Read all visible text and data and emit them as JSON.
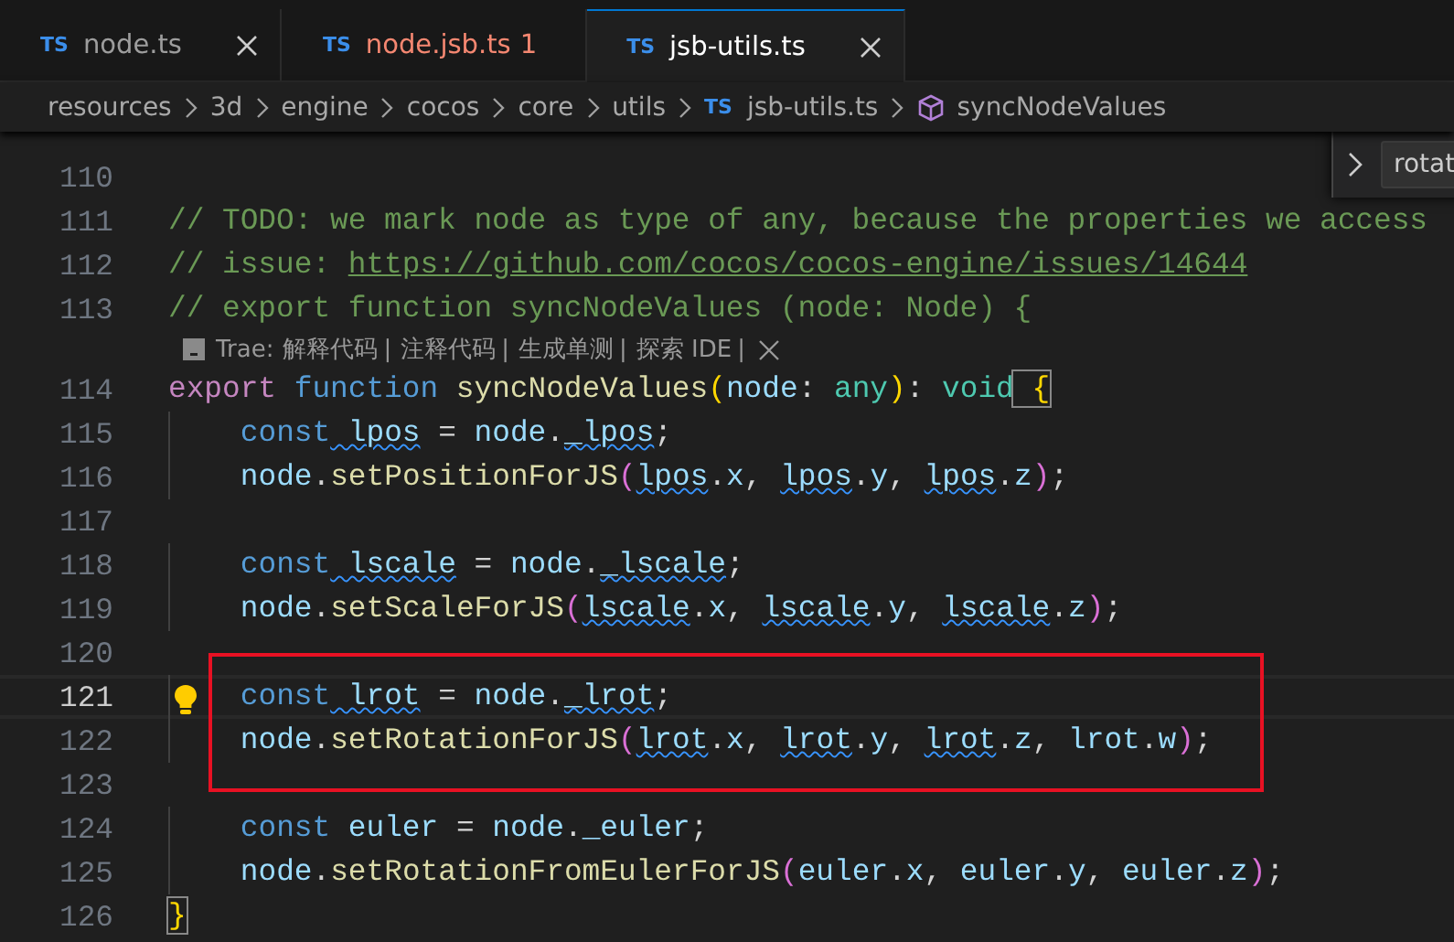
{
  "tabs": [
    {
      "icon_text": "TS",
      "label": "node.ts",
      "selected": false,
      "error": false,
      "closable": true
    },
    {
      "icon_text": "TS",
      "label": "node.jsb.ts",
      "selected": false,
      "error": true,
      "problems": "1",
      "closable": false
    },
    {
      "icon_text": "TS",
      "label": "jsb-utils.ts",
      "selected": true,
      "error": false,
      "closable": true
    }
  ],
  "breadcrumb": [
    {
      "kind": "folder",
      "label": "resources"
    },
    {
      "kind": "folder",
      "label": "3d"
    },
    {
      "kind": "folder",
      "label": "engine"
    },
    {
      "kind": "folder",
      "label": "cocos"
    },
    {
      "kind": "folder",
      "label": "core"
    },
    {
      "kind": "folder",
      "label": "utils"
    },
    {
      "kind": "file",
      "icon_text": "TS",
      "label": "jsb-utils.ts"
    },
    {
      "kind": "symbol",
      "label": "syncNodeValues"
    }
  ],
  "find_widget": {
    "value": "rotat"
  },
  "lines": [
    {
      "kind": "code",
      "number": "110",
      "current": false,
      "indented": false
    },
    {
      "kind": "code",
      "number": "111",
      "current": false,
      "indented": false,
      "tokens": [
        {
          "text": "// TODO: we mark node as type of any, because the properties we access",
          "kind": "comment"
        }
      ]
    },
    {
      "kind": "code",
      "number": "112",
      "current": false,
      "indented": false,
      "tokens": [
        {
          "text": "// issue: ",
          "kind": "comment"
        },
        {
          "text": "https://github.com/cocos/cocos-engine/issues/14644",
          "kind": "link"
        }
      ]
    },
    {
      "kind": "code",
      "number": "113",
      "current": false,
      "indented": false,
      "tokens": [
        {
          "text": "// export function syncNodeValues (node: Node) {",
          "kind": "comment"
        }
      ]
    },
    {
      "kind": "codelens",
      "label": "Trae:",
      "actions": [
        "解释代码",
        "注释代码",
        "生成单测",
        "探索 IDE"
      ],
      "separator": "|"
    },
    {
      "kind": "code",
      "number": "114",
      "current": false,
      "indented": false,
      "tokens": [
        {
          "text": "export",
          "kind": "keyword"
        },
        {
          "text": " function",
          "kind": "storage"
        },
        {
          "text": " syncNodeValues",
          "kind": "function"
        },
        {
          "text": "(",
          "kind": "bracket1"
        },
        {
          "text": "node",
          "kind": "variable"
        },
        {
          "text": ": ",
          "kind": "punct"
        },
        {
          "text": "any",
          "kind": "type"
        },
        {
          "text": ")",
          "kind": "bracket1"
        },
        {
          "text": ": ",
          "kind": "punct"
        },
        {
          "text": "void",
          "kind": "type"
        },
        {
          "text": " {",
          "kind": "bracket_match"
        }
      ]
    },
    {
      "kind": "code",
      "number": "115",
      "current": false,
      "indented": true,
      "tokens": [
        {
          "text": "const",
          "kind": "storage"
        },
        {
          "text": " lpos",
          "kind": "warned"
        },
        {
          "text": " = ",
          "kind": "punct"
        },
        {
          "text": "node",
          "kind": "variable"
        },
        {
          "text": ".",
          "kind": "punct"
        },
        {
          "text": "_lpos",
          "kind": "warned"
        },
        {
          "text": ";",
          "kind": "punct"
        }
      ]
    },
    {
      "kind": "code",
      "number": "116",
      "current": false,
      "indented": true,
      "tokens": [
        {
          "text": "node",
          "kind": "variable"
        },
        {
          "text": ".",
          "kind": "punct"
        },
        {
          "text": "setPositionForJS",
          "kind": "function"
        },
        {
          "text": "(",
          "kind": "bracket2"
        },
        {
          "text": "lpos",
          "kind": "warned"
        },
        {
          "text": ".",
          "kind": "punct"
        },
        {
          "text": "x",
          "kind": "variable"
        },
        {
          "text": ", ",
          "kind": "punct"
        },
        {
          "text": "lpos",
          "kind": "warned"
        },
        {
          "text": ".",
          "kind": "punct"
        },
        {
          "text": "y",
          "kind": "variable"
        },
        {
          "text": ", ",
          "kind": "punct"
        },
        {
          "text": "lpos",
          "kind": "warned"
        },
        {
          "text": ".",
          "kind": "punct"
        },
        {
          "text": "z",
          "kind": "variable"
        },
        {
          "text": ")",
          "kind": "bracket2"
        },
        {
          "text": ";",
          "kind": "punct"
        }
      ]
    },
    {
      "kind": "code",
      "number": "117",
      "current": false,
      "indented": false
    },
    {
      "kind": "code",
      "number": "118",
      "current": false,
      "indented": true,
      "tokens": [
        {
          "text": "const",
          "kind": "storage"
        },
        {
          "text": " lscale",
          "kind": "warned"
        },
        {
          "text": " = ",
          "kind": "punct"
        },
        {
          "text": "node",
          "kind": "variable"
        },
        {
          "text": ".",
          "kind": "punct"
        },
        {
          "text": "_lscale",
          "kind": "warned"
        },
        {
          "text": ";",
          "kind": "punct"
        }
      ]
    },
    {
      "kind": "code",
      "number": "119",
      "current": false,
      "indented": true,
      "tokens": [
        {
          "text": "node",
          "kind": "variable"
        },
        {
          "text": ".",
          "kind": "punct"
        },
        {
          "text": "setScaleForJS",
          "kind": "function"
        },
        {
          "text": "(",
          "kind": "bracket2"
        },
        {
          "text": "lscale",
          "kind": "warned"
        },
        {
          "text": ".",
          "kind": "punct"
        },
        {
          "text": "x",
          "kind": "variable"
        },
        {
          "text": ", ",
          "kind": "punct"
        },
        {
          "text": "lscale",
          "kind": "warned"
        },
        {
          "text": ".",
          "kind": "punct"
        },
        {
          "text": "y",
          "kind": "variable"
        },
        {
          "text": ", ",
          "kind": "punct"
        },
        {
          "text": "lscale",
          "kind": "warned"
        },
        {
          "text": ".",
          "kind": "punct"
        },
        {
          "text": "z",
          "kind": "variable"
        },
        {
          "text": ")",
          "kind": "bracket2"
        },
        {
          "text": ";",
          "kind": "punct"
        }
      ]
    },
    {
      "kind": "code",
      "number": "120",
      "current": false,
      "indented": false
    },
    {
      "kind": "code",
      "number": "121",
      "current": true,
      "indented": true,
      "tokens": [
        {
          "text": "const",
          "kind": "storage"
        },
        {
          "text": " lrot",
          "kind": "warned"
        },
        {
          "text": " = ",
          "kind": "punct"
        },
        {
          "text": "node",
          "kind": "variable"
        },
        {
          "text": ".",
          "kind": "punct"
        },
        {
          "text": "_lrot",
          "kind": "warned"
        },
        {
          "text": ";",
          "kind": "punct"
        }
      ]
    },
    {
      "kind": "code",
      "number": "122",
      "current": false,
      "indented": true,
      "tokens": [
        {
          "text": "node",
          "kind": "variable"
        },
        {
          "text": ".",
          "kind": "punct"
        },
        {
          "text": "setRotationForJS",
          "kind": "function"
        },
        {
          "text": "(",
          "kind": "bracket2"
        },
        {
          "text": "lrot",
          "kind": "warned"
        },
        {
          "text": ".",
          "kind": "punct"
        },
        {
          "text": "x",
          "kind": "variable"
        },
        {
          "text": ", ",
          "kind": "punct"
        },
        {
          "text": "lrot",
          "kind": "warned"
        },
        {
          "text": ".",
          "kind": "punct"
        },
        {
          "text": "y",
          "kind": "variable"
        },
        {
          "text": ", ",
          "kind": "punct"
        },
        {
          "text": "lrot",
          "kind": "warned"
        },
        {
          "text": ".",
          "kind": "punct"
        },
        {
          "text": "z",
          "kind": "variable"
        },
        {
          "text": ", ",
          "kind": "punct"
        },
        {
          "text": "lrot",
          "kind": "variable"
        },
        {
          "text": ".",
          "kind": "punct"
        },
        {
          "text": "w",
          "kind": "variable"
        },
        {
          "text": ")",
          "kind": "bracket2"
        },
        {
          "text": ";",
          "kind": "punct"
        }
      ]
    },
    {
      "kind": "code",
      "number": "123",
      "current": false,
      "indented": false
    },
    {
      "kind": "code",
      "number": "124",
      "current": false,
      "indented": true,
      "tokens": [
        {
          "text": "const",
          "kind": "storage"
        },
        {
          "text": " euler",
          "kind": "variable"
        },
        {
          "text": " = ",
          "kind": "punct"
        },
        {
          "text": "node",
          "kind": "variable"
        },
        {
          "text": ".",
          "kind": "punct"
        },
        {
          "text": "_euler",
          "kind": "variable"
        },
        {
          "text": ";",
          "kind": "punct"
        }
      ]
    },
    {
      "kind": "code",
      "number": "125",
      "current": false,
      "indented": true,
      "tokens": [
        {
          "text": "node",
          "kind": "variable"
        },
        {
          "text": ".",
          "kind": "punct"
        },
        {
          "text": "setRotationFromEulerForJS",
          "kind": "function"
        },
        {
          "text": "(",
          "kind": "bracket2"
        },
        {
          "text": "euler",
          "kind": "variable"
        },
        {
          "text": ".",
          "kind": "punct"
        },
        {
          "text": "x",
          "kind": "variable"
        },
        {
          "text": ", ",
          "kind": "punct"
        },
        {
          "text": "euler",
          "kind": "variable"
        },
        {
          "text": ".",
          "kind": "punct"
        },
        {
          "text": "y",
          "kind": "variable"
        },
        {
          "text": ", ",
          "kind": "punct"
        },
        {
          "text": "euler",
          "kind": "variable"
        },
        {
          "text": ".",
          "kind": "punct"
        },
        {
          "text": "z",
          "kind": "variable"
        },
        {
          "text": ")",
          "kind": "bracket2"
        },
        {
          "text": ";",
          "kind": "punct"
        }
      ]
    },
    {
      "kind": "code",
      "number": "126",
      "current": false,
      "indented": false,
      "tokens": [
        {
          "text": "}",
          "kind": "bracket_match"
        }
      ]
    }
  ]
}
